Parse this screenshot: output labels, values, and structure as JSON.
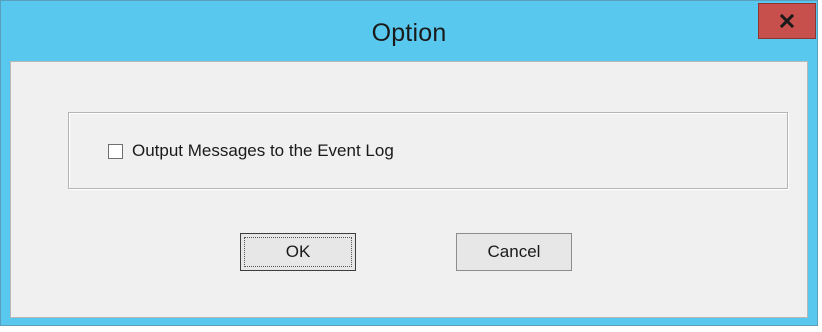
{
  "window": {
    "title": "Option",
    "close_icon": "close-icon",
    "colors": {
      "titlebar": "#58c8ee",
      "close_button": "#c7504d",
      "client": "#f0f0f0"
    }
  },
  "options": {
    "event_log_checkbox": {
      "label": "Output Messages to the Event Log",
      "checked": false
    }
  },
  "buttons": {
    "ok_label": "OK",
    "cancel_label": "Cancel"
  }
}
